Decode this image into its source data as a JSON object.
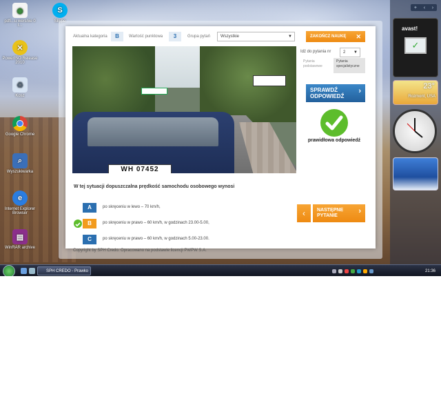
{
  "desktop": {
    "icons": [
      {
        "label": "pdfi...u wersnie 0 I...",
        "icon": "pdf-file-icon",
        "color": "#ffffff"
      },
      {
        "label": "Skype",
        "icon": "skype-icon",
        "color": "#00aff0"
      },
      {
        "label": "PowerISO Release 2010",
        "icon": "poweriso-icon",
        "color": "#e9c21a"
      },
      {
        "label": "Kosz",
        "icon": "recycle-bin-icon",
        "color": "#d7e4f3"
      },
      {
        "label": "Google Chrome",
        "icon": "chrome-icon",
        "color": "#4285f4"
      },
      {
        "label": "Wyszukiwarka",
        "icon": "search-icon",
        "color": "#3b6fb8"
      },
      {
        "label": "Internet Explorer Browser",
        "icon": "internet-explorer-icon",
        "color": "#2a7de1"
      },
      {
        "label": "WinRAR archive",
        "icon": "winrar-icon",
        "color": "#8b2f8b"
      }
    ]
  },
  "gadgets": {
    "avast_logo": "avast!",
    "weather_temp": "23°",
    "weather_city": "Rozmont, USA"
  },
  "taskbar": {
    "task_label": "SPH CREDO - Prawko",
    "time": "21:36"
  },
  "quiz": {
    "category_label": "Aktualna kategoria",
    "category_value": "B",
    "points_label": "Wartość punktowa",
    "points_value": "3",
    "questions_label": "Grupa pytań",
    "questions_value": "Wszystkie",
    "end_button": "ZAKOŃCZ NAUKĘ",
    "jump_label": "Idź do pytania nr",
    "jump_value": "2",
    "type_basic": "Pytania podstawowe",
    "type_special": "Pytania specjalistyczne",
    "check_line1": "SPRAWDŹ",
    "check_line2": "ODPOWIEDŹ",
    "correct_label": "prawidłowa odpowiedź",
    "plate_text": "WH 07452",
    "question": "W tej sytuacji dopuszczalna prędkość samochodu osobowego wynosi",
    "answers": [
      {
        "letter": "A",
        "text": "po skręceniu w lewo – 70 km/h,",
        "color": "#2b6fb0",
        "correct": false
      },
      {
        "letter": "B",
        "text": "po skręceniu w prawo – 60 km/h, w godzinach 23.00-5.00,",
        "color": "#f29b1e",
        "correct": true
      },
      {
        "letter": "C",
        "text": "po skręceniu w prawo – 60 km/h, w godzinach 5.00-23.00.",
        "color": "#2b6fb0",
        "correct": false
      }
    ],
    "next_line1": "NASTĘPNE",
    "next_line2": "PYTANIE",
    "copyright": "Copyright by SPH Credo. Opracowano na podstawie licencji PWPW S.A."
  }
}
